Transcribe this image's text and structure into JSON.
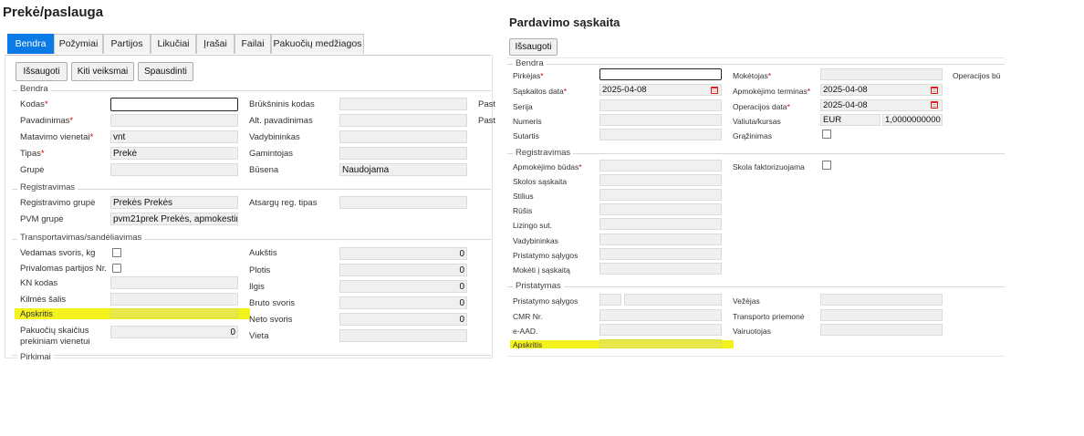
{
  "left": {
    "title": "Prekė/paslauga",
    "tabs": [
      "Bendra",
      "Požymiai",
      "Partijos",
      "Likučiai",
      "Įrašai",
      "Failai",
      "Pakuočių medžiagos"
    ],
    "toolbar": {
      "save": "Išsaugoti",
      "other": "Kiti veiksmai",
      "print": "Spausdinti"
    },
    "bendra": {
      "title": "Bendra",
      "kodas": "Kodas",
      "pavadinimas": "Pavadinimas",
      "matavimo": "Matavimo vienetai",
      "matavimo_val": "vnt",
      "tipas": "Tipas",
      "tipas_val": "Prekė",
      "grupe": "Grupė",
      "bruksninis": "Brūkšninis kodas",
      "alt": "Alt. pavadinimas",
      "vadybininkas": "Vadybininkas",
      "gamintojas": "Gamintojas",
      "busena": "Būsena",
      "busena_val": "Naudojama",
      "cut1": "Past",
      "cut2": "Past"
    },
    "registravimas": {
      "title": "Registravimas",
      "reg_grupe": "Registravimo grupė",
      "reg_grupe_val": "Prekės Prekės",
      "pvm": "PVM grupė",
      "pvm_val": "pvm21prek Prekės, apmokestinamos",
      "atsargu": "Atsargų reg. tipas"
    },
    "transport": {
      "title": "Transportavimas/sandėliavimas",
      "vedamas": "Vedamas svoris, kg",
      "privalomas": "Privalomas partijos Nr.",
      "kn": "KN kodas",
      "kilmes": "Kilmės šalis",
      "apskritis": "Apskritis",
      "pakuociu": "Pakuočių skaičius",
      "pakuociu2": "prekiniam vienetui",
      "pakuociu_val": "0",
      "aukstis": "Aukštis",
      "plotis": "Plotis",
      "ilgis": "Ilgis",
      "bruto": "Bruto svoris",
      "neto": "Neto svoris",
      "vieta": "Vieta",
      "aukstis_val": "0",
      "plotis_val": "0",
      "ilgis_val": "0",
      "bruto_val": "0",
      "neto_val": "0"
    },
    "pirkimai": "Pirkimai"
  },
  "right": {
    "title": "Pardavimo sąskaita",
    "save": "Išsaugoti",
    "bendra": {
      "title": "Bendra",
      "pirkejas": "Pirkėjas",
      "saskaitos_data": "Sąskaitos data",
      "saskaitos_data_val": "2025-04-08",
      "serija": "Serija",
      "numeris": "Numeris",
      "sutartis": "Sutartis",
      "moketojas": "Mokėtojas",
      "operacijos_bu": "Operacijos bū",
      "apmokejimo_terminas": "Apmokėjimo terminas",
      "apmokejimo_val": "2025-04-08",
      "operacijos_data": "Operacijos data",
      "operacijos_val": "2025-04-08",
      "valiuta": "Valiuta/kursas",
      "valiuta_val": "EUR",
      "kursas_val": "1,0000000000",
      "grazinimas": "Grąžinimas"
    },
    "registravimas": {
      "title": "Registravimas",
      "apmokejimo_budas": "Apmokėjimo būdas",
      "skola": "Skola faktorizuojama",
      "skolos": "Skolos sąskaita",
      "stilius": "Stilius",
      "rusis": "Rūšis",
      "lizingo": "Lizingo sut.",
      "vadybininkas": "Vadybininkas",
      "pristatymo": "Pristatymo sąlygos",
      "moketi": "Mokėti į sąskaitą"
    },
    "pristatymas": {
      "title": "Pristatymas",
      "salygos": "Pristatymo sąlygos",
      "cmr": "CMR Nr.",
      "eaad": "e-AAD.",
      "apskritis": "Apskritis",
      "vezejas": "Vežėjas",
      "transporto": "Transporto priemonė",
      "vairuotojas": "Vairuotojas"
    }
  },
  "colors": {
    "accent": "#0a7ae6",
    "highlight": "#f4f21c",
    "required": "#cc0000"
  }
}
